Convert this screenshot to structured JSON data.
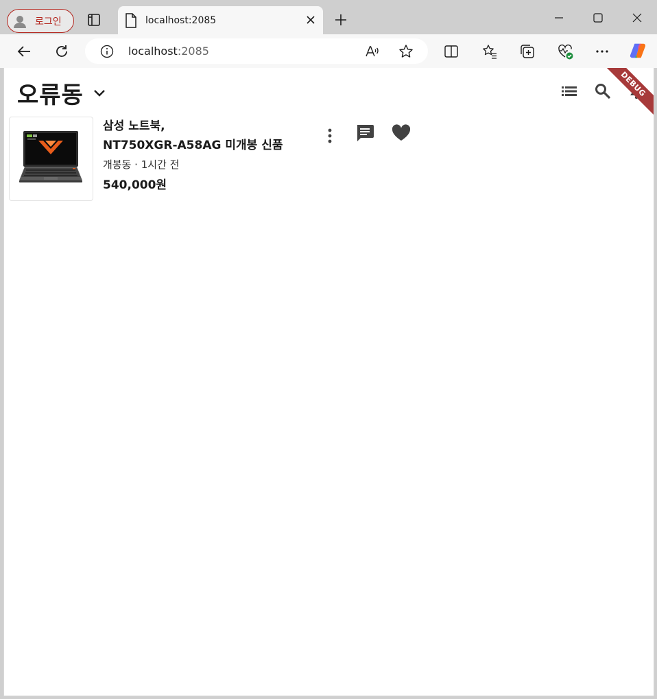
{
  "browser": {
    "profile_label": "로그인",
    "tab_title": "localhost:2085",
    "url_host": "localhost",
    "url_port": ":2085"
  },
  "app": {
    "location_name": "오류동",
    "debug_banner": "DEBUG",
    "items": [
      {
        "title": "삼성 노트북,\n NT750XGR-A58AG 미개봉 신품",
        "meta": "개봉동 · 1시간 전",
        "price": "540,000원"
      }
    ]
  },
  "colors": {
    "accent_red": "#b3261e",
    "debug_ribbon": "#a73a3a",
    "icon_dark": "#424242"
  }
}
